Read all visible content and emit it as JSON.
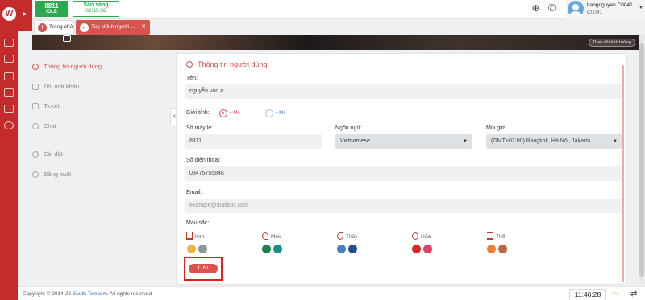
{
  "status": {
    "extension": "8811",
    "agent_state": "IDLE",
    "ready_label": "Sẵn sàng",
    "ready_timer": "02:15:56"
  },
  "user": {
    "name": "hangnguyen.C0041",
    "ext": "C0041"
  },
  "tabs": [
    {
      "label": "Trang chủ"
    },
    {
      "label": "Tùy chỉnh người ..."
    }
  ],
  "banner": {
    "change_cover": "Thay đổi ảnh tường"
  },
  "sidebar": {
    "items": [
      {
        "label": "Thông tin người dùng"
      },
      {
        "label": "Đổi mật khẩu"
      },
      {
        "label": "Ticket"
      },
      {
        "label": "Chat"
      },
      {
        "label": "Cài đặt"
      },
      {
        "label": "Đăng xuất"
      }
    ]
  },
  "form": {
    "title": "Thông tin người dùng",
    "name_label": "Tên:",
    "name_value": "nguyễn văn a",
    "gender_label": "Giới tính:",
    "gender_options": [
      "Ms",
      "Mr"
    ],
    "gender_selected": "Ms",
    "ext_label": "Số máy lẻ:",
    "ext_value": "8811",
    "lang_label": "Ngôn ngữ:",
    "lang_value": "Vietnamese",
    "tz_label": "Múi giờ:",
    "tz_value": "(GMT+07:00) Bangkok, Hà Nội, Jakarta",
    "phone_label": "Số điện thoại:",
    "phone_value": "03475755848",
    "email_label": "Email:",
    "email_placeholder": "example@mailbox.com",
    "color_label": "Màu sắc:",
    "elements": [
      {
        "name": "Kim",
        "icon": "metal-icon",
        "colors": [
          "#f0b43c",
          "#8f959b"
        ]
      },
      {
        "name": "Mộc",
        "icon": "wood-icon",
        "colors": [
          "#1e7f4f",
          "#168f84"
        ]
      },
      {
        "name": "Thủy",
        "icon": "water-icon",
        "colors": [
          "#4a7fc4",
          "#1f4f8c"
        ]
      },
      {
        "name": "Hỏa",
        "icon": "fire-icon",
        "colors": [
          "#e02424",
          "#e0406a"
        ]
      },
      {
        "name": "Thổ",
        "icon": "earth-icon",
        "colors": [
          "#f08030",
          "#c06448"
        ]
      }
    ],
    "save_label": "Lưu"
  },
  "footer": {
    "copyright_prefix": "Copyright © 2014-22 ",
    "brand": "South Telecom",
    "copyright_suffix": ". All rights reserved",
    "clock": "11:46:28"
  },
  "colors": {
    "accent": "#d9534f",
    "rail": "#c62b2b",
    "green": "#2ca94f"
  }
}
